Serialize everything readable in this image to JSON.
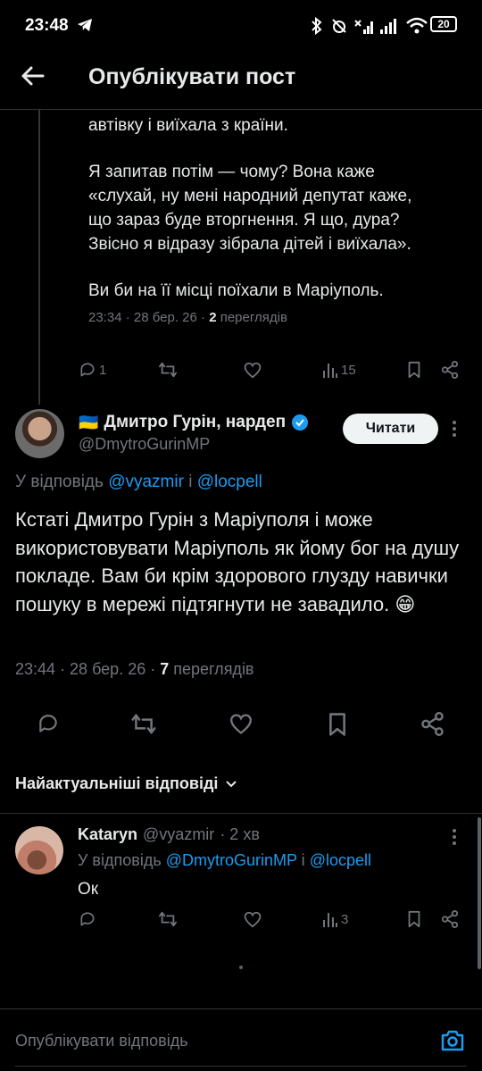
{
  "status_bar": {
    "time": "23:48",
    "battery": "20"
  },
  "header": {
    "title": "Опублікувати пост"
  },
  "parent_tweet": {
    "lines": [
      "автівку і виїхала з країни.",
      "Я запитав потім — чому? Вона каже\n«слухай, ну мені народний депутат каже,\nщо зараз буде вторгнення. Я що, дура?\nЗвісно я відразу зібрала дітей і виїхала».",
      "Ви би на її місці поїхали в Маріуполь."
    ],
    "meta_time": "23:34 · 28 бер. 26 · ",
    "meta_views_count": "2",
    "meta_views_label": " переглядів",
    "reply_count": "1",
    "view_count": "15"
  },
  "main_tweet": {
    "flag": "🇺🇦",
    "name": "Дмитро Гурін, нардеп",
    "handle": "@DmytroGurinMP",
    "follow_label": "Читати",
    "reply_prefix": "У відповідь ",
    "reply_user1": "@vyazmir",
    "reply_and": " і ",
    "reply_user2": "@locpell",
    "text": "Кстаті Дмитро Гурін з Маріуполя і може використовувати Маріуполь як йому бог на душу покладе. Вам би крім здорового глузду навички пошуку в мережі підтягнути не завадило. 😁",
    "meta_time": "23:44 · 28 бер. 26 · ",
    "meta_views_count": "7",
    "meta_views_label": " переглядів"
  },
  "sort": {
    "label": "Найактуальніші відповіді"
  },
  "reply": {
    "name": "Kataryn",
    "handle": "@vyazmir",
    "time": "· 2 хв",
    "reply_prefix": "У відповідь ",
    "reply_user1": "@DmytroGurinMP",
    "reply_and": " і ",
    "reply_user2": "@locpell",
    "text": "Ок",
    "view_count": "3"
  },
  "compose": {
    "placeholder": "Опублікувати відповідь"
  },
  "colors": {
    "background": "#000000",
    "text": "#e7e9ea",
    "muted": "#71767b",
    "link": "#1d9bf0",
    "verified": "#1d9bf0"
  }
}
